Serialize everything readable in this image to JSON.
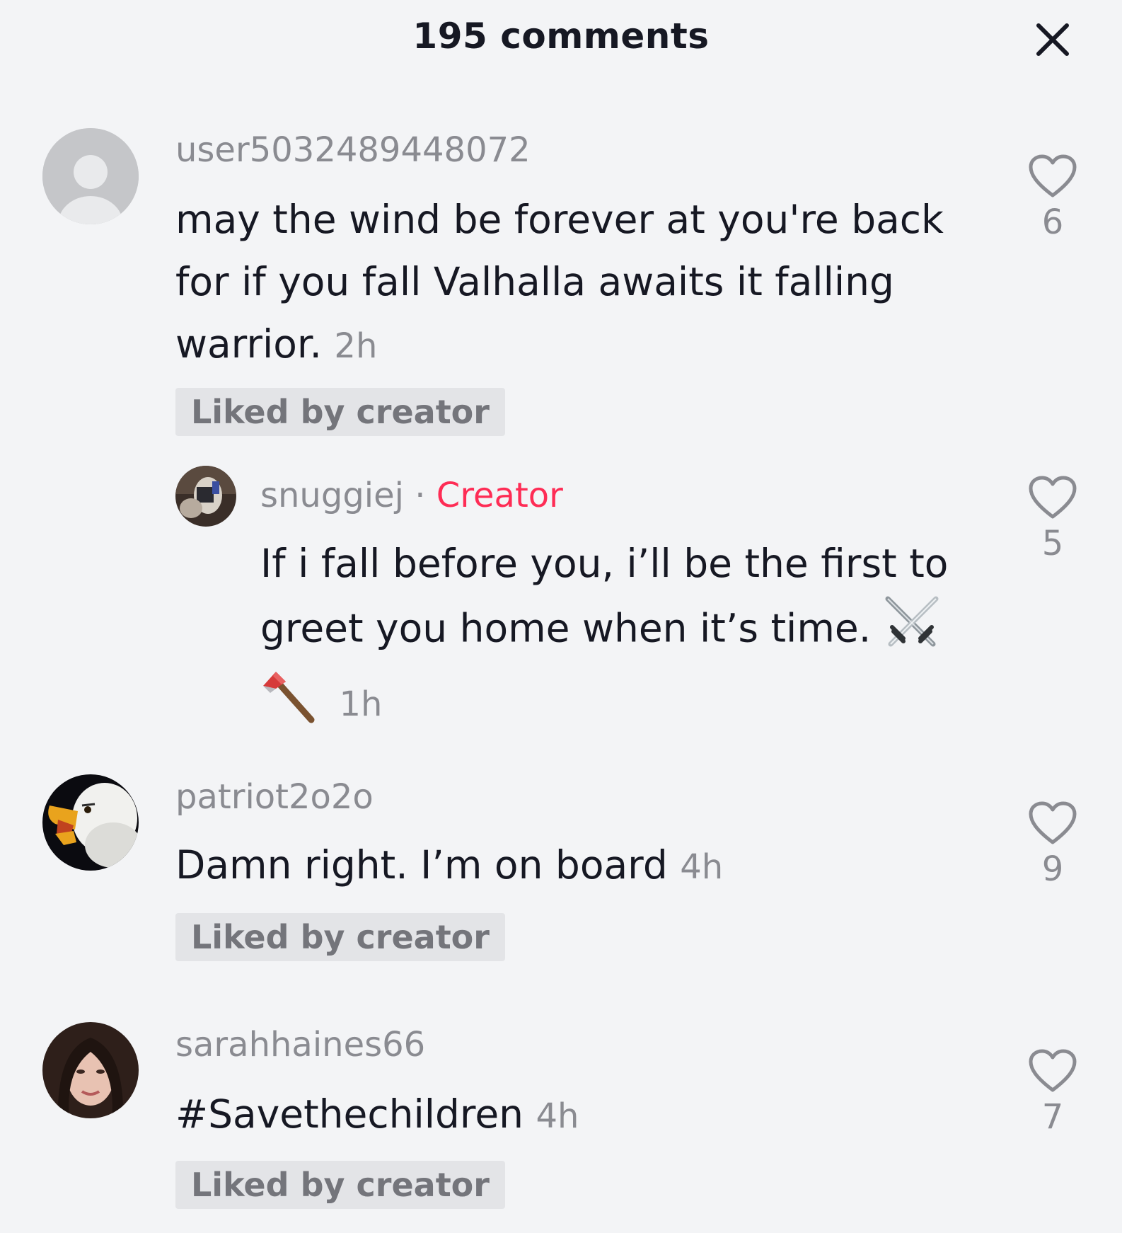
{
  "header": {
    "title": "195 comments",
    "close_icon": "close-icon"
  },
  "comments": [
    {
      "username": "user5032489448072",
      "text": "may the wind be forever at you're back for if you fall Valhalla awaits it falling warrior.",
      "time": "2h",
      "badge": "Liked by creator",
      "likes": "6",
      "avatar": "default-avatar"
    },
    {
      "username": "snuggiej",
      "separator": "·",
      "creator_label": "Creator",
      "text_line1": "If i fall before you, i’ll be the first to",
      "text_line2": "greet you home when it’s time.",
      "emojis": [
        "crossed-swords-emoji",
        "axe-emoji"
      ],
      "time": "1h",
      "likes": "5",
      "avatar": "creator-avatar"
    },
    {
      "username": "patriot2o2o",
      "text": "Damn right. I’m on board",
      "time": "4h",
      "badge": "Liked by creator",
      "likes": "9",
      "avatar": "eagle-avatar"
    },
    {
      "username": "sarahhaines66",
      "text": "#Savethechildren",
      "time": "4h",
      "badge": "Liked by creator",
      "likes": "7",
      "avatar": "woman-avatar"
    }
  ],
  "colors": {
    "background": "#f3f4f6",
    "creator": "#fe2c55",
    "muted": "#8a8b91",
    "text": "#161823",
    "badge_bg": "#e3e4e7"
  }
}
